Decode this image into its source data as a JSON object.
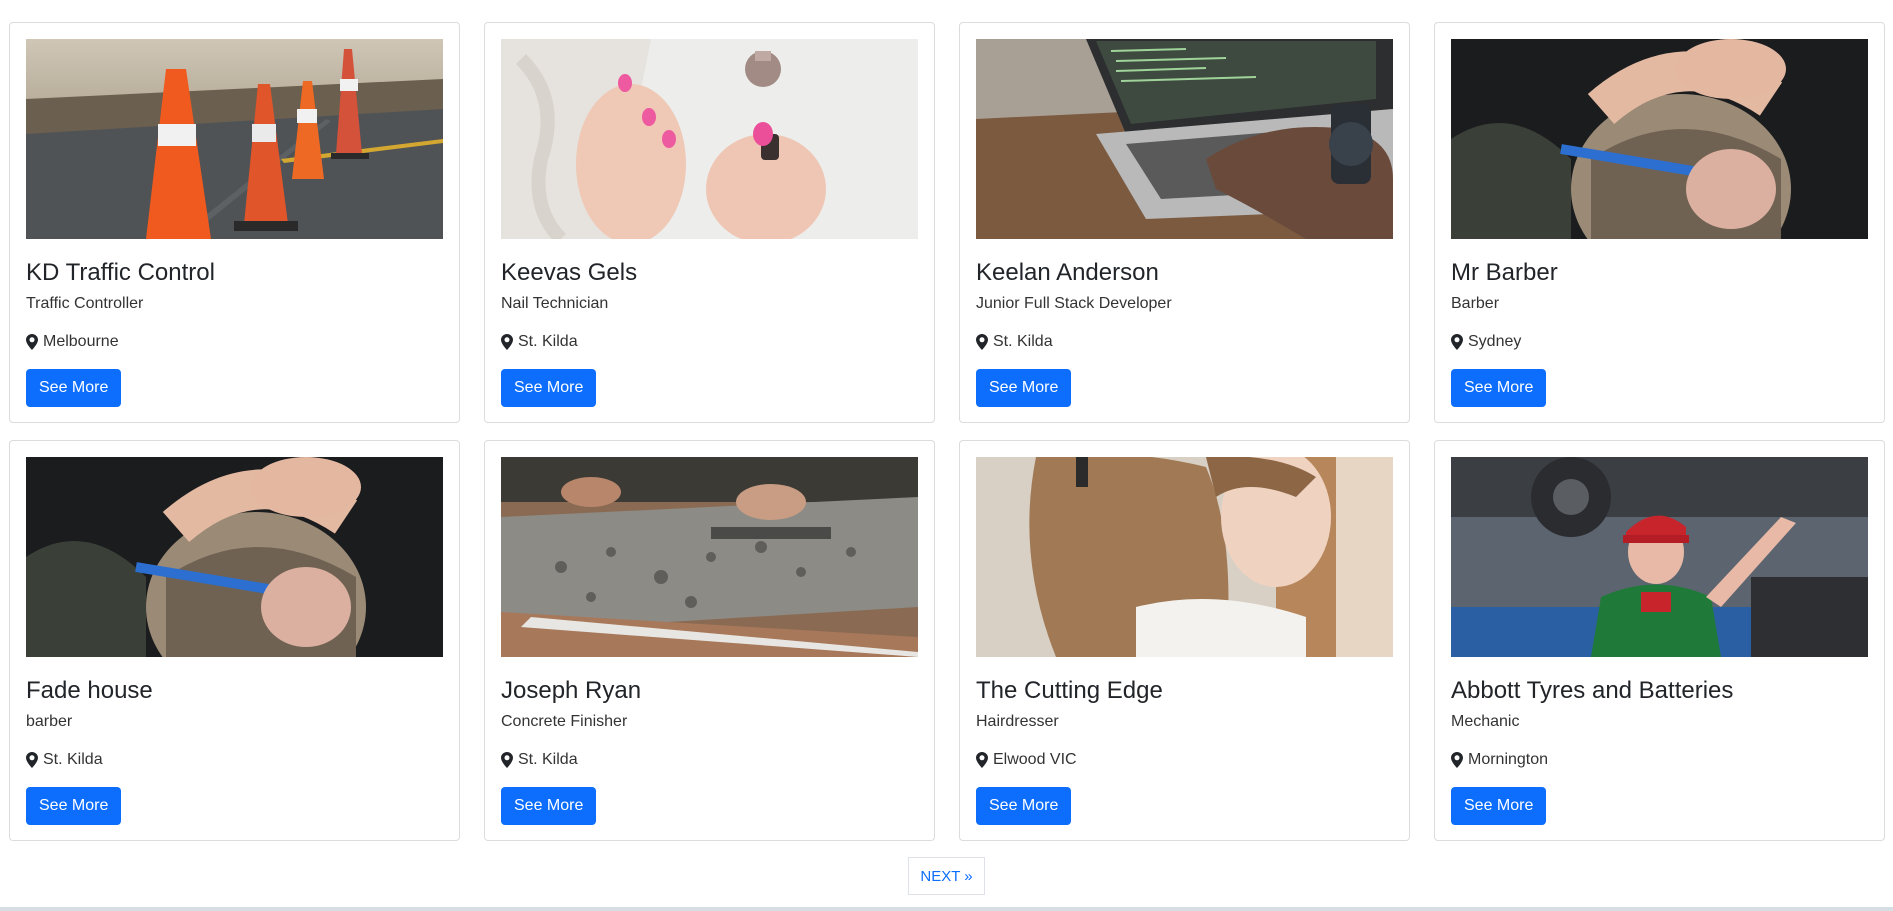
{
  "listings": [
    {
      "title": "KD Traffic Control",
      "subtitle": "Traffic Controller",
      "location": "Melbourne",
      "button": "See More",
      "image": "traffic-cones-photo"
    },
    {
      "title": "Keevas Gels",
      "subtitle": "Nail Technician",
      "location": "St. Kilda",
      "button": "See More",
      "image": "nail-polish-photo"
    },
    {
      "title": "Keelan Anderson",
      "subtitle": "Junior Full Stack Developer",
      "location": "St. Kilda",
      "button": "See More",
      "image": "laptop-coding-photo"
    },
    {
      "title": "Mr Barber",
      "subtitle": "Barber",
      "location": "Sydney",
      "button": "See More",
      "image": "barber-haircut-photo"
    },
    {
      "title": "Fade house",
      "subtitle": "barber",
      "location": "St. Kilda",
      "button": "See More",
      "image": "barber-haircut-photo"
    },
    {
      "title": "Joseph Ryan",
      "subtitle": "Concrete Finisher",
      "location": "St. Kilda",
      "button": "See More",
      "image": "concrete-work-photo"
    },
    {
      "title": "The Cutting Edge",
      "subtitle": "Hairdresser",
      "location": "Elwood VIC",
      "button": "See More",
      "image": "hairdresser-photo"
    },
    {
      "title": "Abbott Tyres and Batteries",
      "subtitle": "Mechanic",
      "location": "Mornington",
      "button": "See More",
      "image": "mechanic-photo"
    }
  ],
  "pagination": {
    "next_label": "NEXT »"
  },
  "colors": {
    "primary": "#0d6efd",
    "border": "#dcdcdc",
    "text": "#212529"
  },
  "icons": {
    "location": "map-pin-icon"
  }
}
